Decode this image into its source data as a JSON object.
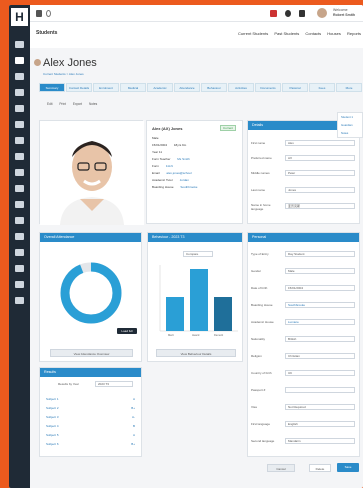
{
  "app": {
    "logo": "H",
    "module_title": "Students"
  },
  "topbar": {
    "welcome_line1": "Welcome",
    "welcome_line2": "Robert Smith"
  },
  "topnav": [
    "Current Students",
    "Past Students",
    "Contacts",
    "Houses",
    "Reports"
  ],
  "student": {
    "name": "Alex Jones",
    "subcrumb": "Current Students > Alex Jones",
    "card_name": "Alex (AX) Jones",
    "badge": "Current",
    "details": [
      {
        "label": "Male",
        "value": ""
      },
      {
        "label": "15/01/2004",
        "value": "18yrs 9m"
      },
      {
        "label": "Year 11",
        "value": ""
      },
      {
        "label": "Form Teacher",
        "value": "Ms Smith"
      },
      {
        "label": "Form",
        "value": "11LN"
      },
      {
        "label": "Email",
        "value": "alex.jones@school"
      },
      {
        "label": "Academic Tutor",
        "value": "Jordan"
      },
      {
        "label": "Boarding House",
        "value": "Southbrooke"
      }
    ]
  },
  "tabs": [
    "Summary",
    "Contact Details",
    "Enrolment",
    "Medical",
    "Academic",
    "Attendance",
    "Behaviour",
    "Activities",
    "Documents",
    "Pastoral",
    "Fees",
    "More"
  ],
  "toolbar": {
    "items": [
      "Edit",
      "Print",
      "Export",
      "Notes"
    ]
  },
  "details_panel": {
    "title": "Details",
    "fields": [
      {
        "label": "First name",
        "value": "Alex"
      },
      {
        "label": "Preferred name",
        "value": "AX"
      },
      {
        "label": "Middle names",
        "value": "Peter"
      },
      {
        "label": "Last name",
        "value": "Jones"
      },
      {
        "label": "Name in home language",
        "value": "亚历克斯"
      }
    ],
    "right_menu": [
      "Student 1",
      "Guardian",
      "Notes"
    ]
  },
  "attendance": {
    "title": "Overall Attendance",
    "value_pct": 94,
    "button": "View Attendance Overview",
    "small_btn": "Load full"
  },
  "behaviour": {
    "title": "Behaviour - 2023 T3",
    "select_label": "Compare",
    "bars": [
      {
        "label": "Merit",
        "value": 35
      },
      {
        "label": "Award",
        "value": 60
      },
      {
        "label": "Demerit",
        "value": 35
      }
    ],
    "button": "View Behaviour Details"
  },
  "personal": {
    "title": "Personal",
    "fields": [
      {
        "label": "Type of Entry",
        "value": "Day Student"
      },
      {
        "label": "Gender",
        "value": "Male"
      },
      {
        "label": "Date of birth",
        "value": "15/01/2004"
      },
      {
        "label": "Boarding House",
        "value": "Southbrooke"
      },
      {
        "label": "Academic House",
        "value": "Lumiere"
      },
      {
        "label": "Nationality",
        "value": "British"
      },
      {
        "label": "Religion",
        "value": "Christian"
      },
      {
        "label": "Country of birth",
        "value": "UK"
      },
      {
        "label": "Passport #",
        "value": ""
      },
      {
        "label": "Visa",
        "value": "Not Required"
      },
      {
        "label": "First language",
        "value": "English"
      },
      {
        "label": "Second language",
        "value": "Mandarin"
      }
    ]
  },
  "results": {
    "title": "Results",
    "select_label": "Results by Year",
    "select_value": "2023 T3",
    "rows": [
      {
        "label": "Subject 1",
        "value": "A"
      },
      {
        "label": "Subject 2",
        "value": "B+"
      },
      {
        "label": "Subject 3",
        "value": "A-"
      },
      {
        "label": "Subject 4",
        "value": "B"
      },
      {
        "label": "Subject 5",
        "value": "A"
      },
      {
        "label": "Subject 6",
        "value": "B+"
      }
    ]
  },
  "footer": {
    "cancel": "Cancel",
    "delete": "Delete",
    "save": "Save"
  },
  "colors": {
    "accent": "#2a8bc9",
    "sidebar": "#1f2a36",
    "frame": "#ec5a1e"
  }
}
